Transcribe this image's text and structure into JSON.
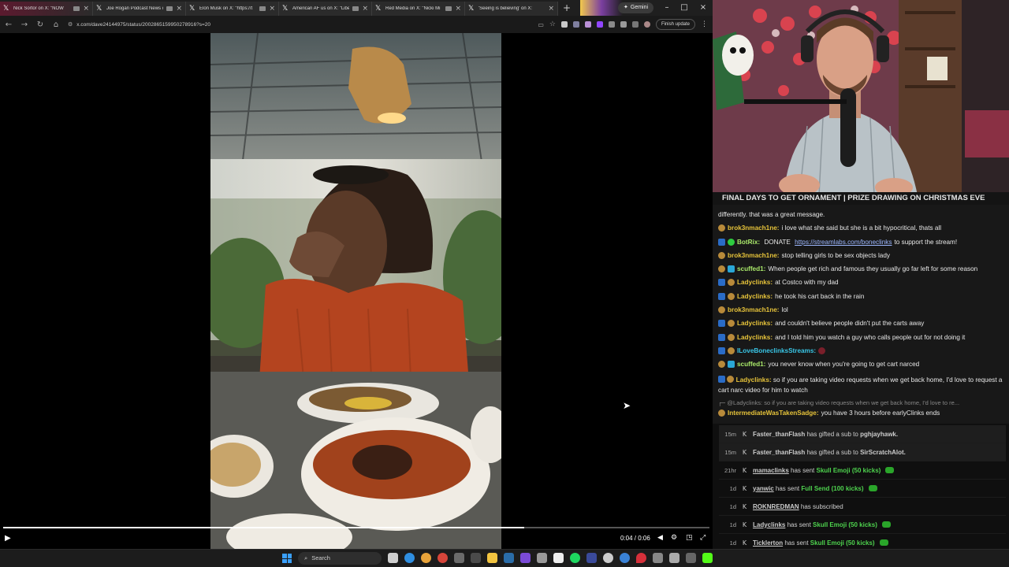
{
  "browser": {
    "tabs": [
      {
        "title": "Nick Sortor on X: \"NOW"
      },
      {
        "title": "Joe Rogan Podcast News o"
      },
      {
        "title": "Elon Musk on X: \"https://t"
      },
      {
        "title": "American AF us on X: \"Libe"
      },
      {
        "title": "Red Media on X: \"Nicki Mi"
      },
      {
        "title": "'Seeing is believing' on X:"
      }
    ],
    "gemini_label": "Gemini",
    "url": "x.com/dave24144975/status/2002865159950278916?s=20",
    "finish_update_label": "Finish update"
  },
  "video": {
    "current_time": "0:04",
    "duration": "0:06",
    "time_display": "0:04 / 0:06",
    "progress_fraction": 0.738
  },
  "stream": {
    "banner": "FINAL DAYS TO GET ORNAMENT | PRIZE DRAWING ON CHRISTMAS EVE"
  },
  "chat": {
    "top_text": "differently. that was a great message.",
    "messages": [
      {
        "user": "brok3nmach1ne:",
        "text": " i love what she said but she is a bit hypocritical, thats all"
      },
      {
        "user": "BotRix:",
        "text_before": " DONATE ",
        "link": "https://streamlabs.com/boneclinks",
        "text": " to support the stream!"
      },
      {
        "user": "brok3nmach1ne:",
        "text": " stop telling girls to be sex objects lady"
      },
      {
        "user": "scuffed1:",
        "text": " When people get rich and famous they usually go far left for some reason"
      },
      {
        "user": "Ladyclinks:",
        "text": " at Costco with my dad"
      },
      {
        "user": "Ladyclinks:",
        "text": " he took his cart back in the rain"
      },
      {
        "user": "brok3nmach1ne:",
        "text": " lol"
      },
      {
        "user": "Ladyclinks:",
        "text": " and couldn't believe people didn't put the carts away"
      },
      {
        "user": "Ladyclinks:",
        "text": " and I told him you watch a guy who calls people out for not doing it"
      },
      {
        "user": "ILoveBoneclinksStreams:",
        "text": ""
      },
      {
        "user": "scuffed1:",
        "text": " you never know when you're going to get cart narced"
      },
      {
        "user": "Ladyclinks:",
        "text": " so if you are taking video requests when we get back home, I'd love to request a cart narc video for him to watch"
      }
    ],
    "reply_preview": "@Ladyclinks: so if you are taking video requests when we get back home, I'd love to re...",
    "last_message": {
      "user": "IntermediateWasTakenSadge:",
      "text": " you have 3 hours before earlyClinks ends"
    }
  },
  "events": [
    {
      "time": "15m",
      "user": "Faster_thanFlash",
      "text": " has gifted a sub to ",
      "target": "pghjayhawk."
    },
    {
      "time": "15m",
      "user": "Faster_thanFlash",
      "text": " has gifted a sub to ",
      "target": "SirScratchAlot."
    },
    {
      "time": "21hr",
      "user": "mamaclinks",
      "text": " has sent ",
      "item": "Skull Emoji (50 kicks)"
    },
    {
      "time": "1d",
      "user": "yanwic",
      "text": " has sent ",
      "item": "Full Send (100 kicks)"
    },
    {
      "time": "1d",
      "user": "ROKNREDMAN",
      "text": " has subscribed"
    },
    {
      "time": "1d",
      "user": "Ladyclinks",
      "text": " has sent ",
      "item": "Skull Emoji (50 kicks)"
    },
    {
      "time": "1d",
      "user": "Ticklerton",
      "text": " has sent ",
      "item": "Skull Emoji (50 kicks)"
    }
  ],
  "taskbar": {
    "search_placeholder": "Search"
  },
  "colors": {
    "accent_green": "#4ed34e",
    "chat_bg": "#181818",
    "tab_active": "#5b1a2e"
  }
}
